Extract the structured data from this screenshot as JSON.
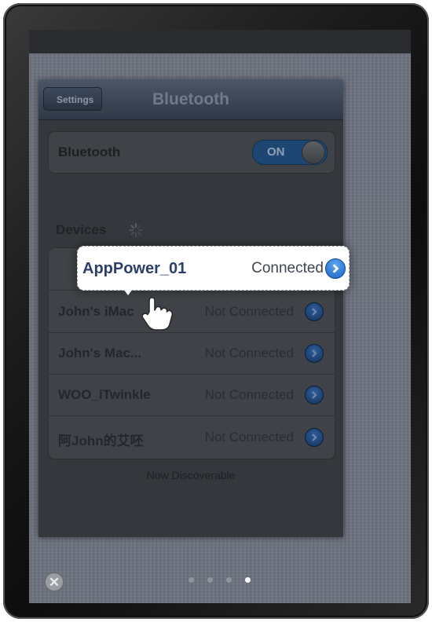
{
  "navbar": {
    "back_label": "Settings",
    "title": "Bluetooth"
  },
  "bluetooth_toggle": {
    "label": "Bluetooth",
    "state": "ON"
  },
  "devices": {
    "header": "Devices",
    "highlighted": {
      "name": "AppPower_01",
      "status": "Connected"
    },
    "list": [
      {
        "name": "John's iMac",
        "status": "Not Connected"
      },
      {
        "name": "John's Mac...",
        "status": "Not Connected"
      },
      {
        "name": "WOO_iTwinkle",
        "status": "Not Connected"
      },
      {
        "name": "阿John的艾呸",
        "status": "Not Connected"
      }
    ],
    "footer": "Now Discoverable"
  },
  "page_indicator": {
    "count": 4,
    "active_index": 3
  },
  "colors": {
    "toggle_on": "#1e4672",
    "disclosure": "#1b63c4",
    "callout_bg": "#ffffff"
  },
  "icons": [
    "close-icon",
    "spinner-icon",
    "disclosure-icon",
    "hand-pointer-icon"
  ]
}
